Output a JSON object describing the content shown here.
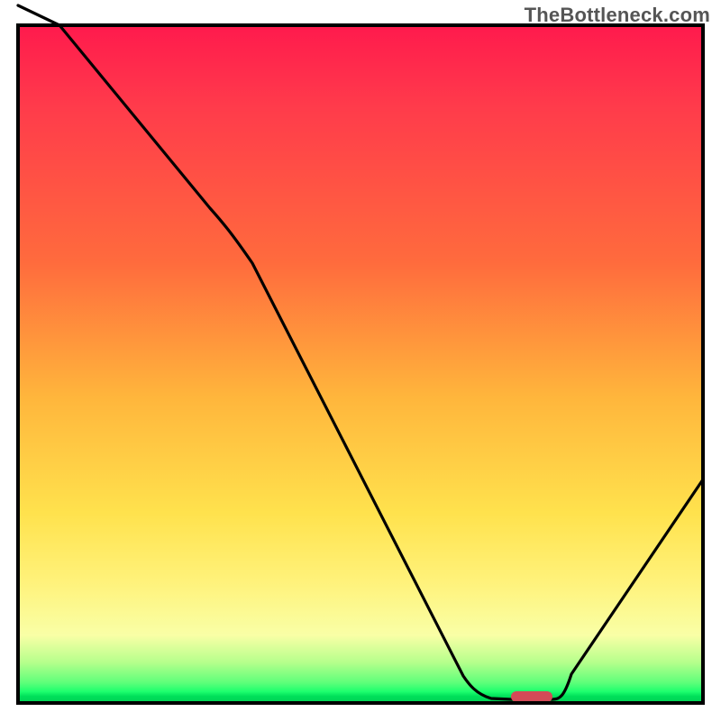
{
  "watermark": "TheBottleneck.com",
  "chart_data": {
    "type": "line",
    "title": "",
    "xlabel": "",
    "ylabel": "",
    "xlim": [
      0,
      100
    ],
    "ylim": [
      0,
      100
    ],
    "grid": false,
    "legend": false,
    "background_gradient": {
      "direction": "vertical",
      "stops": [
        {
          "pos": 0.0,
          "color": "#ff1a4d"
        },
        {
          "pos": 0.12,
          "color": "#ff3b4b"
        },
        {
          "pos": 0.35,
          "color": "#ff6b3d"
        },
        {
          "pos": 0.55,
          "color": "#ffb63c"
        },
        {
          "pos": 0.72,
          "color": "#ffe24d"
        },
        {
          "pos": 0.82,
          "color": "#fff27a"
        },
        {
          "pos": 0.9,
          "color": "#f9ffa6"
        },
        {
          "pos": 0.94,
          "color": "#b6ff8c"
        },
        {
          "pos": 0.97,
          "color": "#5eff7a"
        },
        {
          "pos": 0.99,
          "color": "#00e05a"
        },
        {
          "pos": 1.0,
          "color": "#00d055"
        }
      ]
    },
    "series": [
      {
        "name": "bottleneck-curve",
        "x": [
          0,
          6,
          28,
          65,
          72,
          78,
          80,
          100
        ],
        "values": [
          103,
          100,
          73,
          4,
          0.5,
          0.5,
          4,
          33
        ]
      }
    ],
    "marker": {
      "name": "optimal-range",
      "x_start": 72,
      "x_end": 78,
      "y": 0.6,
      "color": "#d44a57",
      "shape": "rounded-bar"
    }
  },
  "colors": {
    "frame": "#000000",
    "curve": "#000000",
    "marker": "#d44a57",
    "watermark": "#555555"
  }
}
